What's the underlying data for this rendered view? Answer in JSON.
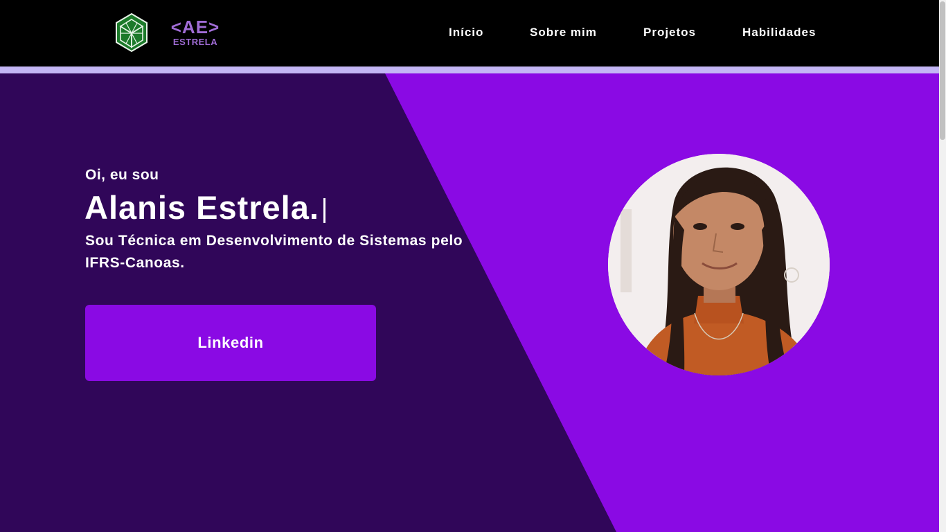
{
  "header": {
    "logo_text": "<AE>",
    "logo_subtext": "ESTRELA",
    "nav": [
      {
        "label": "Início"
      },
      {
        "label": "Sobre mim"
      },
      {
        "label": "Projetos"
      },
      {
        "label": "Habilidades"
      }
    ]
  },
  "hero": {
    "greeting": "Oi, eu sou",
    "name": "Alanis Estrela.",
    "description": "Sou Técnica em Desenvolvimento de Sistemas pelo IFRS-Canoas.",
    "button_label": "Linkedin"
  },
  "colors": {
    "header_bg": "#000000",
    "strip": "#c3b6f5",
    "hero_dark": "#300659",
    "hero_accent": "#8a0ae4",
    "logo_purple": "#a06cd5",
    "cube_green": "#1c7a2a"
  },
  "icons": {
    "brand": "cube-logo-icon",
    "avatar": "profile-photo"
  }
}
